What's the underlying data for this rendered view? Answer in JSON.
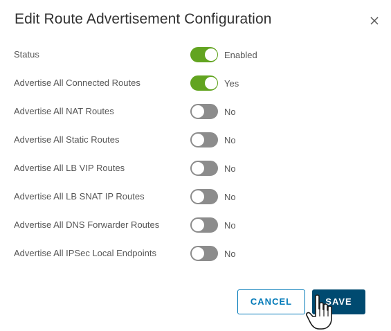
{
  "dialog": {
    "title": "Edit Route Advertisement Configuration",
    "close_icon": "close-icon"
  },
  "rows": [
    {
      "label": "Status",
      "state": "on",
      "value": "Enabled"
    },
    {
      "label": "Advertise All Connected Routes",
      "state": "on",
      "value": "Yes"
    },
    {
      "label": "Advertise All NAT Routes",
      "state": "off",
      "value": "No"
    },
    {
      "label": "Advertise All Static Routes",
      "state": "off",
      "value": "No"
    },
    {
      "label": "Advertise All LB VIP Routes",
      "state": "off",
      "value": "No"
    },
    {
      "label": "Advertise All LB SNAT IP Routes",
      "state": "off",
      "value": "No"
    },
    {
      "label": "Advertise All DNS Forwarder Routes",
      "state": "off",
      "value": "No"
    },
    {
      "label": "Advertise All IPSec Local Endpoints",
      "state": "off",
      "value": "No"
    }
  ],
  "footer": {
    "cancel_label": "CANCEL",
    "save_label": "SAVE"
  },
  "colors": {
    "toggle_on": "#62a420",
    "toggle_off": "#8c8c8c",
    "primary": "#004a70",
    "outline": "#0079b8"
  },
  "cursor": "hand-pointer-icon"
}
